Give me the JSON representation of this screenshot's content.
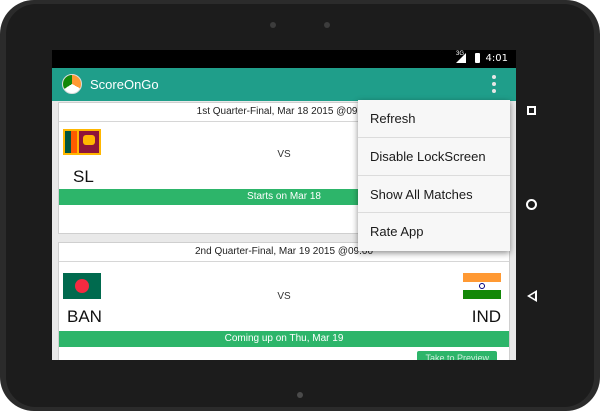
{
  "status_bar": {
    "time": "4:01",
    "network": "3G"
  },
  "app": {
    "title": "ScoreOnGo"
  },
  "matches": [
    {
      "header": "1st Quarter-Final, Mar 18 2015 @09:00",
      "vs": "VS",
      "team1": "SL",
      "team2": "",
      "status": "Starts on Mar 18",
      "action": ""
    },
    {
      "header": "2nd Quarter-Final, Mar 19 2015 @09:00",
      "vs": "VS",
      "team1": "BAN",
      "team2": "IND",
      "status": "Coming up on Thu, Mar 19",
      "action": "Take to Preview"
    }
  ],
  "menu": {
    "items": [
      "Refresh",
      "Disable LockScreen",
      "Show All Matches",
      "Rate App"
    ]
  },
  "colors": {
    "app_bar": "#1f9e8a",
    "status_green": "#2db56a"
  },
  "icons": {
    "overflow": "overflow-menu-icon",
    "recent": "recent-apps-icon",
    "home": "home-icon",
    "back": "back-icon"
  }
}
